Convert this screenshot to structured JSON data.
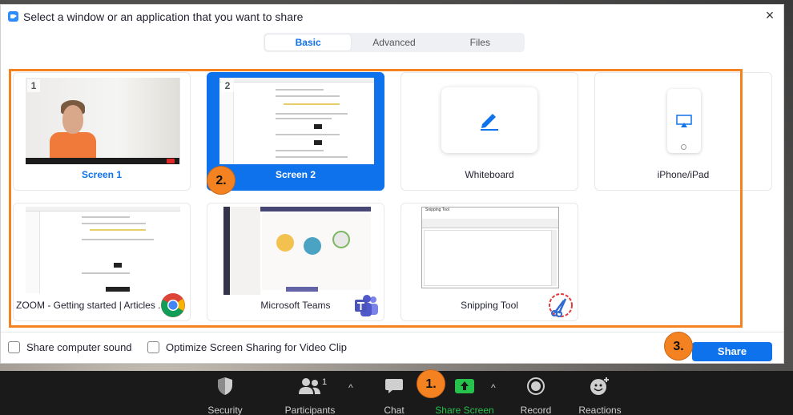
{
  "dialog": {
    "title": "Select a window or an application that you want to share",
    "close_label": "×"
  },
  "tabs": [
    {
      "label": "Basic",
      "active": true
    },
    {
      "label": "Advanced",
      "active": false
    },
    {
      "label": "Files",
      "active": false
    }
  ],
  "sources": [
    {
      "label": "Screen 1",
      "number": "1",
      "kind": "screen"
    },
    {
      "label": "Screen 2",
      "number": "2",
      "kind": "screen",
      "selected": true
    },
    {
      "label": "Whiteboard",
      "kind": "whiteboard"
    },
    {
      "label": "iPhone/iPad",
      "kind": "device"
    },
    {
      "label": "ZOOM - Getting started | Articles ...",
      "kind": "window",
      "app_icon": "chrome-icon"
    },
    {
      "label": "Microsoft Teams",
      "kind": "window",
      "app_icon": "teams-icon"
    },
    {
      "label": "Snipping Tool",
      "kind": "window",
      "app_icon": "snipping-tool-icon"
    }
  ],
  "snip_title": "Snipping Tool",
  "options": {
    "computer_sound": "Share computer sound",
    "optimize_video": "Optimize Screen Sharing for Video Clip"
  },
  "share_button": "Share",
  "steps": [
    "1.",
    "2.",
    "3."
  ],
  "toolbar": {
    "security": "Security",
    "participants": "Participants",
    "participants_count": "1",
    "chat": "Chat",
    "share_screen": "Share Screen",
    "record": "Record",
    "reactions": "Reactions",
    "caret": "^"
  },
  "colors": {
    "accent": "#0e72ed",
    "annotation": "#f58220",
    "share_green": "#27c24c"
  }
}
